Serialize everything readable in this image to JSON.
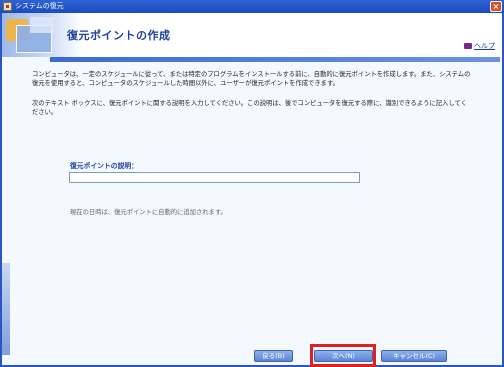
{
  "window": {
    "title": "システムの復元",
    "close_symbol": "×"
  },
  "header": {
    "title": "復元ポイントの作成",
    "help_label": "ヘルプ"
  },
  "content": {
    "paragraph1": "コンピュータは、一定のスケジュールに従って、または特定のプログラムをインストールする前に、自動的に復元ポイントを作成します。また、システムの復元を使用すると、コンピュータのスケジュールした時間以外に、ユーザーが復元ポイントを作成できます。",
    "paragraph2": "次のテキスト ボックスに、復元ポイントに関する説明を入力してください。この説明は、後でコンピュータを復元する際に、識別できるように記入してください。",
    "description_label": "復元ポイントの説明：",
    "description_value": "",
    "note": "現在の日時は、復元ポイントに自動的に追加されます。"
  },
  "buttons": {
    "back": "戻る(B)",
    "next": "次へ(N)",
    "cancel": "キャンセル(C)"
  },
  "colors": {
    "title_blue": "#1e3f9e",
    "highlight_red": "#e01f1f",
    "button_blue": "#5c84d6"
  }
}
